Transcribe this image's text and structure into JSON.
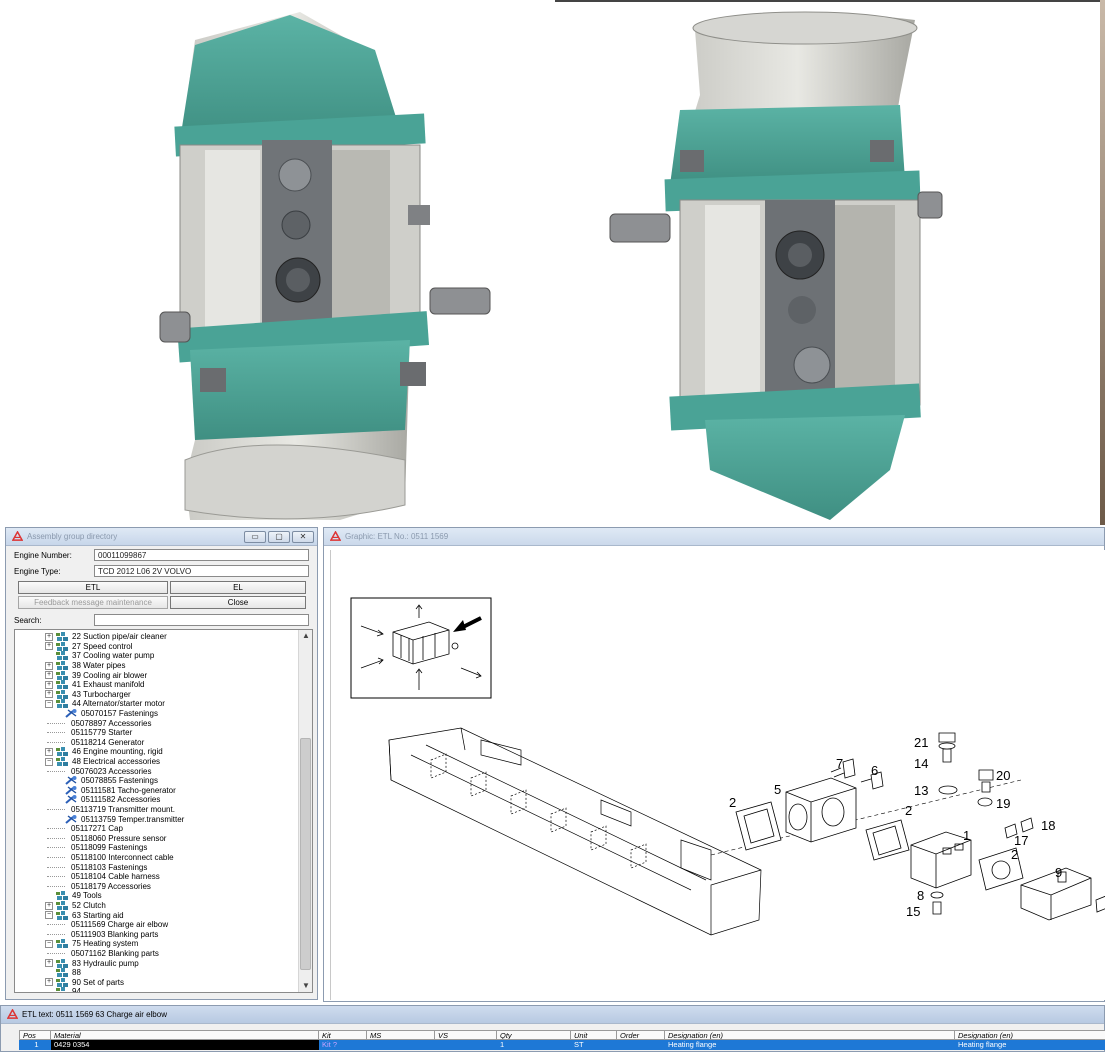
{
  "assembly_window": {
    "title": "Assembly group directory",
    "engine_number_label": "Engine Number:",
    "engine_number": "00011099867",
    "engine_type_label": "Engine Type:",
    "engine_type": "TCD 2012 L06 2V VOLVO",
    "etl_button": "ETL",
    "el_button": "EL",
    "feedback_button": "Feedback message maintenance",
    "close_button": "Close",
    "search_label": "Search:",
    "search_value": "",
    "tree": [
      {
        "level": 0,
        "expander": "+",
        "icon": "group",
        "label": "22  Suction pipe/air cleaner"
      },
      {
        "level": 0,
        "expander": "+",
        "icon": "group",
        "label": "27  Speed control"
      },
      {
        "level": 0,
        "expander": "",
        "icon": "group",
        "label": "37  Cooling water pump"
      },
      {
        "level": 0,
        "expander": "+",
        "icon": "group",
        "label": "38  Water pipes"
      },
      {
        "level": 0,
        "expander": "+",
        "icon": "group",
        "label": "39  Cooling air blower"
      },
      {
        "level": 0,
        "expander": "+",
        "icon": "group",
        "label": "41  Exhaust manifold"
      },
      {
        "level": 0,
        "expander": "+",
        "icon": "group",
        "label": "43  Turbocharger"
      },
      {
        "level": 0,
        "expander": "-",
        "icon": "group",
        "label": "44  Alternator/starter motor"
      },
      {
        "level": 1,
        "expander": "",
        "icon": "wrench",
        "label": "05070157  Fastenings"
      },
      {
        "level": 1,
        "expander": "",
        "icon": "",
        "label": "05078897  Accessories"
      },
      {
        "level": 1,
        "expander": "",
        "icon": "",
        "label": "05115779  Starter"
      },
      {
        "level": 1,
        "expander": "",
        "icon": "",
        "label": "05118214  Generator"
      },
      {
        "level": 0,
        "expander": "+",
        "icon": "group",
        "label": "46  Engine mounting, rigid"
      },
      {
        "level": 0,
        "expander": "-",
        "icon": "group",
        "label": "48  Electrical accessories"
      },
      {
        "level": 1,
        "expander": "",
        "icon": "",
        "label": "05076023  Accessories"
      },
      {
        "level": 1,
        "expander": "",
        "icon": "wrench",
        "label": "05078855  Fastenings"
      },
      {
        "level": 1,
        "expander": "",
        "icon": "wrench",
        "label": "05111581  Tacho-generator"
      },
      {
        "level": 1,
        "expander": "",
        "icon": "wrench",
        "label": "05111582  Accessories"
      },
      {
        "level": 1,
        "expander": "",
        "icon": "",
        "label": "05113719  Transmitter mount."
      },
      {
        "level": 1,
        "expander": "",
        "icon": "wrench",
        "label": "05113759  Temper.transmitter"
      },
      {
        "level": 1,
        "expander": "",
        "icon": "",
        "label": "05117271  Cap"
      },
      {
        "level": 1,
        "expander": "",
        "icon": "",
        "label": "05118060  Pressure sensor"
      },
      {
        "level": 1,
        "expander": "",
        "icon": "",
        "label": "05118099  Fastenings"
      },
      {
        "level": 1,
        "expander": "",
        "icon": "",
        "label": "05118100  Interconnect cable"
      },
      {
        "level": 1,
        "expander": "",
        "icon": "",
        "label": "05118103  Fastenings"
      },
      {
        "level": 1,
        "expander": "",
        "icon": "",
        "label": "05118104  Cable harness"
      },
      {
        "level": 1,
        "expander": "",
        "icon": "",
        "label": "05118179  Accessories"
      },
      {
        "level": 0,
        "expander": "",
        "icon": "group",
        "label": "49  Tools"
      },
      {
        "level": 0,
        "expander": "+",
        "icon": "group",
        "label": "52  Clutch"
      },
      {
        "level": 0,
        "expander": "-",
        "icon": "group",
        "label": "63  Starting aid"
      },
      {
        "level": 1,
        "expander": "",
        "icon": "",
        "label": "05111569  Charge air elbow"
      },
      {
        "level": 1,
        "expander": "",
        "icon": "",
        "label": "05111903  Blanking parts"
      },
      {
        "level": 0,
        "expander": "-",
        "icon": "group",
        "label": "75  Heating system"
      },
      {
        "level": 1,
        "expander": "",
        "icon": "",
        "label": "05071162  Blanking parts"
      },
      {
        "level": 0,
        "expander": "+",
        "icon": "group",
        "label": "83  Hydraulic pump"
      },
      {
        "level": 0,
        "expander": "",
        "icon": "group",
        "label": "88"
      },
      {
        "level": 0,
        "expander": "+",
        "icon": "group",
        "label": "90  Set of parts"
      },
      {
        "level": 0,
        "expander": "",
        "icon": "group",
        "label": "94"
      }
    ]
  },
  "graphic_window": {
    "title": "Graphic: ETL No.: 0511 1569",
    "callouts": [
      "21",
      "14",
      "20",
      "13",
      "19",
      "7",
      "6",
      "5",
      "2",
      "2",
      "1",
      "18",
      "17",
      "2",
      "9",
      "8",
      "15"
    ]
  },
  "etl_window": {
    "title": "ETL text: 0511 1569   63   Charge air elbow",
    "columns": [
      "Pos",
      "Material",
      "Kit",
      "MS",
      "VS",
      "Qty",
      "Unit",
      "Order",
      "Designation (en)",
      "Designation (en)"
    ],
    "rows": [
      {
        "pos": "1",
        "material": "0429 0354",
        "kit": "Kit ?",
        "ms": "",
        "vs": "",
        "qty": "1",
        "unit": "ST",
        "order": "",
        "designation1": "Heating flange",
        "designation2": "Heating flange"
      }
    ]
  },
  "colors": {
    "window_bg": "#f0f0f0",
    "title_gradient_top": "#dfe9f5",
    "selection_blue": "#1e78d6",
    "part_teal": "#4fa89a"
  }
}
